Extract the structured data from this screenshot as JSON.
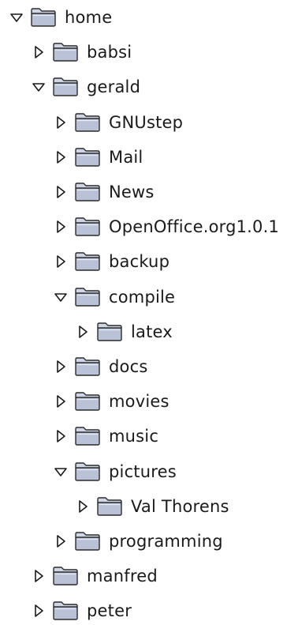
{
  "tree": {
    "items": [
      {
        "label": "home",
        "depth": 0,
        "expanded": true
      },
      {
        "label": "babsi",
        "depth": 1,
        "expanded": false
      },
      {
        "label": "gerald",
        "depth": 1,
        "expanded": true
      },
      {
        "label": "GNUstep",
        "depth": 2,
        "expanded": false
      },
      {
        "label": "Mail",
        "depth": 2,
        "expanded": false
      },
      {
        "label": "News",
        "depth": 2,
        "expanded": false
      },
      {
        "label": "OpenOffice.org1.0.1",
        "depth": 2,
        "expanded": false
      },
      {
        "label": "backup",
        "depth": 2,
        "expanded": false
      },
      {
        "label": "compile",
        "depth": 2,
        "expanded": true
      },
      {
        "label": "latex",
        "depth": 3,
        "expanded": false
      },
      {
        "label": "docs",
        "depth": 2,
        "expanded": false
      },
      {
        "label": "movies",
        "depth": 2,
        "expanded": false
      },
      {
        "label": "music",
        "depth": 2,
        "expanded": false
      },
      {
        "label": "pictures",
        "depth": 2,
        "expanded": true
      },
      {
        "label": "Val Thorens",
        "depth": 3,
        "expanded": false
      },
      {
        "label": "programming",
        "depth": 2,
        "expanded": false
      },
      {
        "label": "manfred",
        "depth": 1,
        "expanded": false
      },
      {
        "label": "peter",
        "depth": 1,
        "expanded": false
      }
    ]
  },
  "colors": {
    "folder_fill": "#b9c2d6",
    "folder_tab": "#cfd6e5",
    "folder_stroke": "#2b2b2b",
    "arrow_stroke": "#1a1a1a"
  },
  "icons": {
    "expanded": "triangle-down-icon",
    "collapsed": "triangle-right-icon",
    "folder": "folder-icon"
  }
}
